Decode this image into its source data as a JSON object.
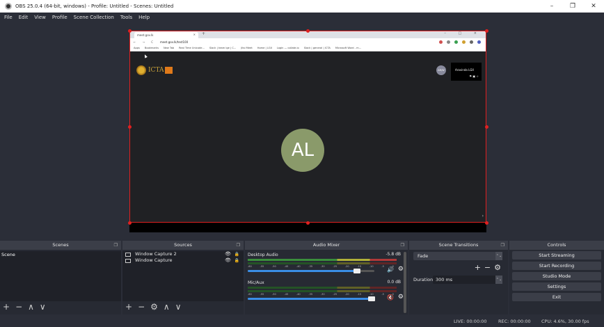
{
  "window": {
    "title": "OBS 25.0.4 (64-bit, windows) - Profile: Untitled - Scenes: Untitled",
    "minimize": "–",
    "maximize": "❐",
    "close": "✕"
  },
  "menu": [
    "File",
    "Edit",
    "View",
    "Profile",
    "Scene Collection",
    "Tools",
    "Help"
  ],
  "preview": {
    "browser_tab": "meet.gov.lk",
    "tab_close": "×",
    "new_tab": "+",
    "window_controls": "– □ ×",
    "nav": "← → C",
    "url": "meet.gov.lk/test100",
    "bookmarks": [
      "Apps",
      "Bookmarks",
      "New Tab",
      "Real Time Unicode...",
      "Slack | team lge | C...",
      "Jitsi Meet",
      "Home | LGII",
      "Login — collate.io",
      "Slack | general | ICTA",
      "Microsoft Word - m..."
    ],
    "logo_text": "ICTA",
    "small_avatar": "AR/W",
    "self_view_name": "Aravinda LGII",
    "self_view_icons": "⚑ ▣ ☆",
    "participant_initials": "AL",
    "next_arrow": "›"
  },
  "docks": {
    "scenes": {
      "title": "Scenes",
      "items": [
        "Scene"
      ],
      "footer": [
        "+",
        "−",
        "∧",
        "∨"
      ]
    },
    "sources": {
      "title": "Sources",
      "items": [
        {
          "name": "Window Capture 2",
          "visible": "👁",
          "lock": "🔒"
        },
        {
          "name": "Window Capture",
          "visible": "👁",
          "lock": "🔒"
        }
      ],
      "footer": [
        "+",
        "−",
        "⚙",
        "∧",
        "∨"
      ]
    },
    "mixer": {
      "title": "Audio Mixer",
      "scale": [
        "-60",
        "-55",
        "-50",
        "-45",
        "-40",
        "-35",
        "-30",
        "-25",
        "-20",
        "-15",
        "-10",
        "-5",
        "0"
      ],
      "channels": [
        {
          "name": "Desktop Audio",
          "db": "-5.8 dB",
          "volume": 0.86,
          "muted": false,
          "speaker": "🔊",
          "gear": "⚙"
        },
        {
          "name": "Mic/Aux",
          "db": "0.0 dB",
          "volume": 0.98,
          "muted": true,
          "speaker": "🔇",
          "gear": "⚙"
        }
      ]
    },
    "transitions": {
      "title": "Scene Transitions",
      "selected": "Fade",
      "select_arrows": "⌃⌄",
      "tools": [
        "+",
        "−",
        "⚙"
      ],
      "duration_label": "Duration",
      "duration_value": "300 ms"
    },
    "controls": {
      "title": "Controls",
      "buttons": [
        "Start Streaming",
        "Start Recording",
        "Studio Mode",
        "Settings",
        "Exit"
      ]
    },
    "float_icon": "❐"
  },
  "status": {
    "live": "LIVE: 00:00:00",
    "rec": "REC: 00:00:00",
    "cpu": "CPU: 4.6%, 30.00 fps"
  }
}
